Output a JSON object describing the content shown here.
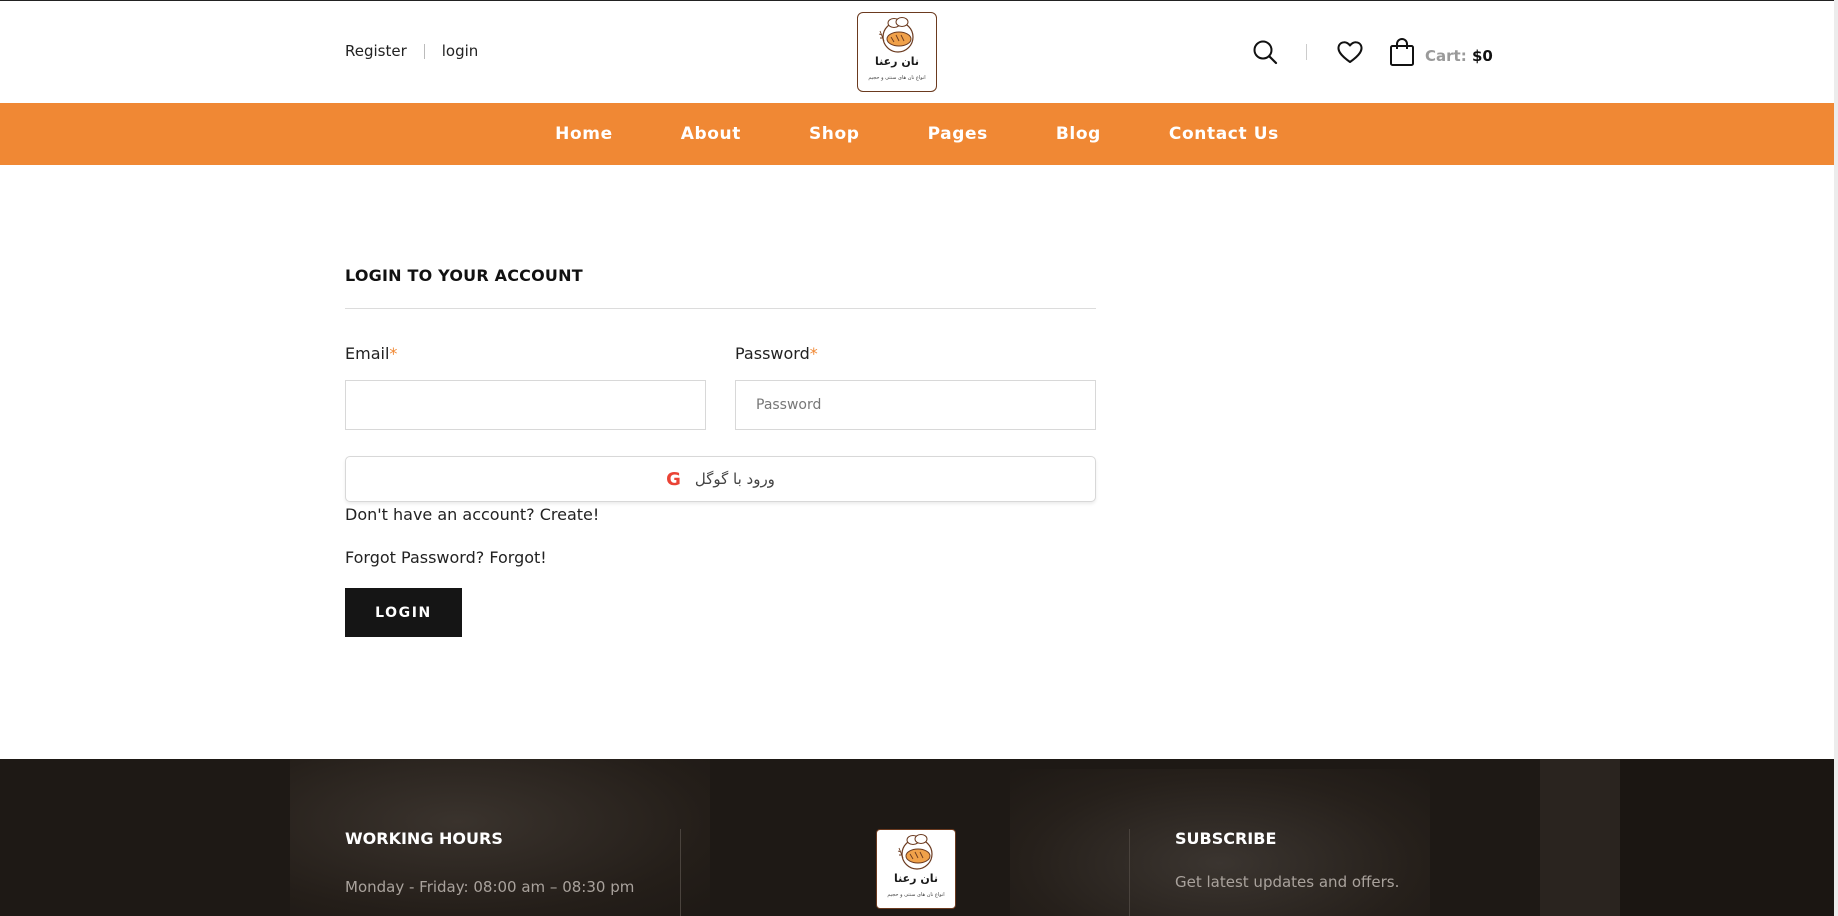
{
  "header": {
    "register_label": "Register",
    "login_label": "login",
    "logo": {
      "brand": "نان رعنا",
      "tagline": "انواع نان های سنتی و حجیم"
    },
    "cart": {
      "label": "Cart:",
      "amount": "$0"
    },
    "icons": [
      "search-icon",
      "heart-icon",
      "shopping-bag-icon"
    ]
  },
  "nav": {
    "items": [
      "Home",
      "About",
      "Shop",
      "Pages",
      "Blog",
      "Contact Us"
    ]
  },
  "login_form": {
    "title": "LOGIN TO YOUR ACCOUNT",
    "email_label": "Email",
    "password_label": "Password",
    "required_mark": "*",
    "email_value": "",
    "email_placeholder": "",
    "password_value": "",
    "password_placeholder": "Password",
    "google_icon_glyph": "G",
    "google_label": "ورود با گوگل",
    "create_prompt": "Don't have an account?",
    "create_link": "Create!",
    "forgot_prompt": "Forgot Password?",
    "forgot_link": "Forgot!",
    "submit_label": "LOGIN"
  },
  "footer": {
    "working_hours_title": "WORKING HOURS",
    "working_hours_line": "Monday - Friday: 08:00 am – 08:30 pm",
    "subscribe_title": "SUBSCRIBE",
    "subscribe_text": "Get latest updates and offers.",
    "logo": {
      "brand": "نان رعنا",
      "tagline": "انواع نان های سنتی و حجیم"
    }
  },
  "colors": {
    "accent": "#f08834",
    "button_dark": "#151515",
    "footer_bg": "#1e1915",
    "google_red": "#ea4335",
    "logo_bread": "#f0a14a"
  }
}
